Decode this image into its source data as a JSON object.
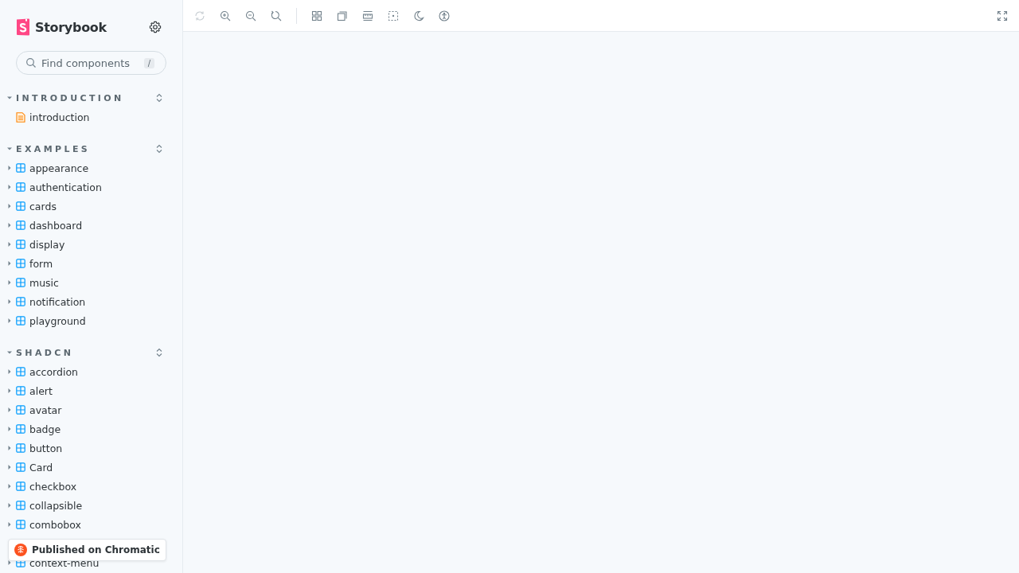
{
  "sidebar": {
    "brand": "Storybook",
    "search": {
      "placeholder": "Find components",
      "shortcut": "/"
    },
    "sections": [
      {
        "title": "INTRODUCTION",
        "expanded": true,
        "items": [
          {
            "kind": "doc",
            "label": "introduction"
          }
        ]
      },
      {
        "title": "EXAMPLES",
        "expanded": true,
        "items": [
          {
            "kind": "component",
            "label": "appearance",
            "expanded": false
          },
          {
            "kind": "component",
            "label": "authentication",
            "expanded": false
          },
          {
            "kind": "component",
            "label": "cards",
            "expanded": false
          },
          {
            "kind": "component",
            "label": "dashboard",
            "expanded": false
          },
          {
            "kind": "component",
            "label": "display",
            "expanded": false
          },
          {
            "kind": "component",
            "label": "form",
            "expanded": false
          },
          {
            "kind": "component",
            "label": "music",
            "expanded": false
          },
          {
            "kind": "component",
            "label": "notification",
            "expanded": false
          },
          {
            "kind": "component",
            "label": "playground",
            "expanded": false
          }
        ]
      },
      {
        "title": "SHADCN",
        "expanded": true,
        "items": [
          {
            "kind": "component",
            "label": "accordion",
            "expanded": false
          },
          {
            "kind": "component",
            "label": "alert",
            "expanded": false
          },
          {
            "kind": "component",
            "label": "avatar",
            "expanded": false
          },
          {
            "kind": "component",
            "label": "badge",
            "expanded": false
          },
          {
            "kind": "component",
            "label": "button",
            "expanded": false
          },
          {
            "kind": "component",
            "label": "Card",
            "expanded": false
          },
          {
            "kind": "component",
            "label": "checkbox",
            "expanded": false
          },
          {
            "kind": "component",
            "label": "collapsible",
            "expanded": false
          },
          {
            "kind": "component",
            "label": "combobox",
            "expanded": false
          },
          {
            "kind": "covered"
          },
          {
            "kind": "component",
            "label": "context-menu",
            "expanded": false
          }
        ]
      }
    ],
    "badge": "Published on Chromatic"
  },
  "toolbar": {
    "tools": [
      {
        "kind": "sync",
        "disabled": true
      },
      {
        "kind": "zoom-in",
        "disabled": false
      },
      {
        "kind": "zoom-out",
        "disabled": false
      },
      {
        "kind": "zoom-reset",
        "disabled": false
      },
      {
        "kind": "separator"
      },
      {
        "kind": "grid",
        "disabled": false
      },
      {
        "kind": "background",
        "disabled": false
      },
      {
        "kind": "measure",
        "disabled": false
      },
      {
        "kind": "outline",
        "disabled": false
      },
      {
        "kind": "theme",
        "disabled": false
      },
      {
        "kind": "accessibility",
        "disabled": false
      }
    ],
    "right": [
      {
        "kind": "fullscreen",
        "disabled": false
      }
    ]
  }
}
